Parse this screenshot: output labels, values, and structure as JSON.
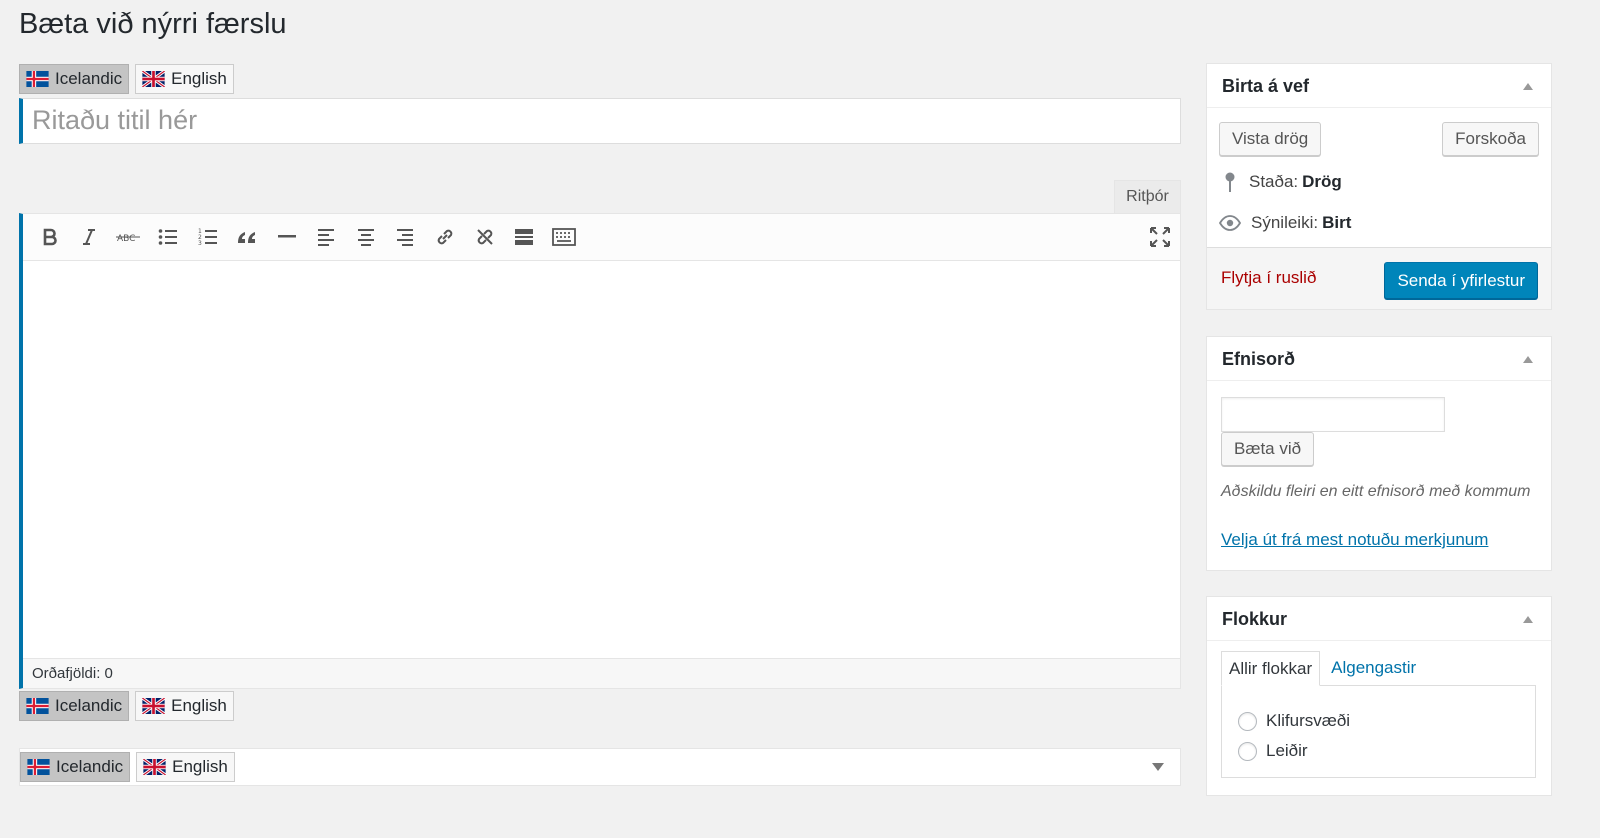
{
  "page": {
    "title": "Bæta við nýrri færslu"
  },
  "languages": [
    {
      "label": "Icelandic",
      "flag": "iceland-flag-icon"
    },
    {
      "label": "English",
      "flag": "uk-flag-icon"
    }
  ],
  "title_field": {
    "placeholder": "Ritaðu titil hér"
  },
  "editor": {
    "visual_tab": "Ritþór",
    "word_count": "Orðafjöldi: 0",
    "toolbar": [
      "bold-icon",
      "italic-icon",
      "strikethrough-icon",
      "bullet-list-icon",
      "numbered-list-icon",
      "blockquote-icon",
      "horizontal-rule-icon",
      "align-left-icon",
      "align-center-icon",
      "align-right-icon",
      "link-icon",
      "unlink-icon",
      "read-more-icon",
      "toolbar-toggle-icon",
      "fullscreen-icon"
    ]
  },
  "publish": {
    "title": "Birta á vef",
    "save_draft": "Vista drög",
    "preview": "Forskoða",
    "status_label": "Staða:",
    "status_value": "Drög",
    "visibility_label": "Sýnileiki:",
    "visibility_value": "Birt",
    "trash": "Flytja í ruslið",
    "submit": "Senda í yfirlestur"
  },
  "tags": {
    "title": "Efnisorð",
    "add_button": "Bæta við",
    "howto": "Aðskildu fleiri en eitt efnisorð með kommum",
    "choose_link": "Velja út frá mest notuðu merkjunum"
  },
  "categories": {
    "title": "Flokkur",
    "tab_all": "Allir flokkar",
    "tab_popular": "Algengastir",
    "items": [
      "Klifursvæði",
      "Leiðir"
    ]
  },
  "colors": {
    "accent": "#0073aa",
    "primary_button": "#0085ba",
    "trash": "#aa0000"
  }
}
